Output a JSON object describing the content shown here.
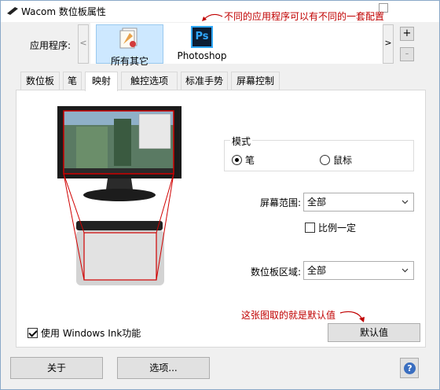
{
  "window": {
    "title": "Wacom 数位板属性"
  },
  "annotations": {
    "top": "不同的应用程序可以有不同的一套配置",
    "bottom": "这张图取的就是默认值"
  },
  "apps": {
    "label": "应用程序:",
    "scroll_left": "<",
    "scroll_right": ">",
    "add": "+",
    "remove": "-",
    "items": [
      {
        "label": "所有其它",
        "icon": "document-icon",
        "selected": true
      },
      {
        "label": "Photoshop",
        "icon": "photoshop-icon",
        "icon_text": "Ps",
        "selected": false
      }
    ]
  },
  "tabs": [
    {
      "label": "数位板"
    },
    {
      "label": "笔"
    },
    {
      "label": "映射",
      "active": true
    },
    {
      "label": "触控选项"
    },
    {
      "label": "标准手势"
    },
    {
      "label": "屏幕控制"
    }
  ],
  "mapping": {
    "mode_title": "模式",
    "mode_options": [
      {
        "label": "笔",
        "selected": true
      },
      {
        "label": "鼠标",
        "selected": false
      }
    ],
    "screen_area_label": "屏幕范围:",
    "screen_area_value": "全部",
    "proportional_label": "比例一定",
    "proportional_checked": false,
    "tablet_area_label": "数位板区域:",
    "tablet_area_value": "全部",
    "windows_ink_label": "使用 Windows Ink功能",
    "windows_ink_checked": true,
    "default_button": "默认值"
  },
  "footer": {
    "about": "关于",
    "options": "选项...",
    "help": "?"
  },
  "colors": {
    "annotation": "#c00000",
    "selected_tile": "#cde8ff",
    "photoshop_blue": "#31a8ff"
  }
}
